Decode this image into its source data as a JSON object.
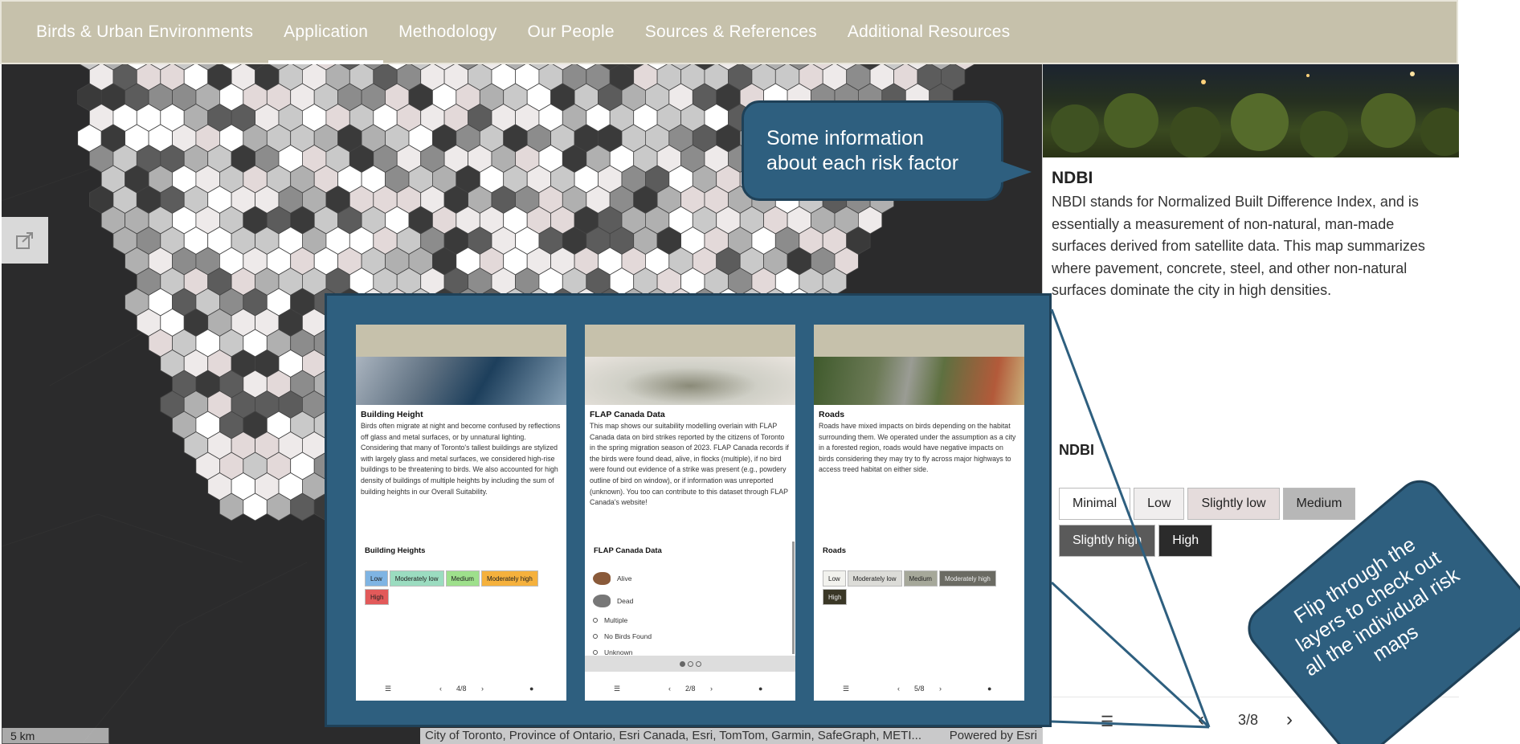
{
  "nav": {
    "items": [
      "Birds & Urban Environments",
      "Application",
      "Methodology",
      "Our People",
      "Sources & References",
      "Additional Resources"
    ],
    "active_index": 1
  },
  "map": {
    "scale_label": "5 km",
    "attribution": "City of Toronto, Province of Ontario, Esri Canada, Esri, TomTom, Garmin, SafeGraph, METI...",
    "powered_by": "Powered by Esri"
  },
  "panel": {
    "title": "NDBI",
    "body": "NBDI stands for Normalized Built Difference Index, and is essentially a measurement of non-natural, man-made surfaces derived from satellite data. This map summarizes where pavement, concrete, steel, and other non-natural surfaces dominate the city in high densities.",
    "legend_title": "NDBI",
    "legend": [
      {
        "label": "Minimal",
        "bg": "#ffffff",
        "fg": "#222222"
      },
      {
        "label": "Low",
        "bg": "#f0eeee",
        "fg": "#222222"
      },
      {
        "label": "Slightly low",
        "bg": "#e5dcdc",
        "fg": "#222222"
      },
      {
        "label": "Medium",
        "bg": "#b7b7b7",
        "fg": "#222222"
      },
      {
        "label": "Slightly high",
        "bg": "#5a5a5a",
        "fg": "#ffffff"
      },
      {
        "label": "High",
        "bg": "#2b2b2b",
        "fg": "#ffffff"
      }
    ],
    "footer_page": "3/8"
  },
  "callouts": {
    "top": "Some information about each risk factor",
    "bottom": "Flip through the layers to check out all the individual risk maps"
  },
  "previews": [
    {
      "title": "Building Height",
      "body": "Birds often migrate at night and become confused by reflections off glass and metal surfaces, or by unnatural lighting. Considering that many of Toronto's tallest buildings are stylized with largely glass and metal surfaces, we considered high-rise buildings to be threatening to birds. We also accounted for high density of buildings of multiple heights by including the sum of building heights in our Overall Suitability.",
      "legend_title": "Building Heights",
      "legend": [
        {
          "label": "Low",
          "bg": "#7fb4e3"
        },
        {
          "label": "Moderately low",
          "bg": "#9bdcc0"
        },
        {
          "label": "Medium",
          "bg": "#9ee08c"
        },
        {
          "label": "Moderately high",
          "bg": "#f5b13d"
        },
        {
          "label": "High",
          "bg": "#e25a5a"
        }
      ],
      "page": "4/8"
    },
    {
      "title": "FLAP Canada Data",
      "body": "This map shows our suitability modelling overlain with FLAP Canada data on bird strikes reported by the citizens of Toronto in the spring migration season of 2023. FLAP Canada records if the birds were found dead, alive, in flocks (multiple), if no bird were found out evidence of a strike was present (e.g., powdery outline of bird on window), or if information was unreported (unknown). You too can contribute to this dataset through FLAP Canada's website!",
      "legend_title": "FLAP Canada Data",
      "rows": [
        "Alive",
        "Dead",
        "Multiple",
        "No Birds Found",
        "Unknown"
      ],
      "page": "2/8"
    },
    {
      "title": "Roads",
      "body": "Roads have mixed impacts on birds depending on the habitat surrounding them. We operated under the assumption as a city in a forested region, roads would have negative impacts on birds considering they may try to fly across major highways to access treed habitat on either side.",
      "legend_title": "Roads",
      "legend": [
        {
          "label": "Low",
          "bg": "#f2f2ee"
        },
        {
          "label": "Moderately low",
          "bg": "#dcdcd8"
        },
        {
          "label": "Medium",
          "bg": "#a6a89a"
        },
        {
          "label": "Moderately high",
          "bg": "#6b6b63"
        },
        {
          "label": "High",
          "bg": "#3a3726"
        }
      ],
      "page": "5/8"
    }
  ],
  "colors": {
    "nav_bg": "#c6c1ab",
    "callout": "#2e5f7f",
    "map_bg": "#2b2b2c"
  }
}
